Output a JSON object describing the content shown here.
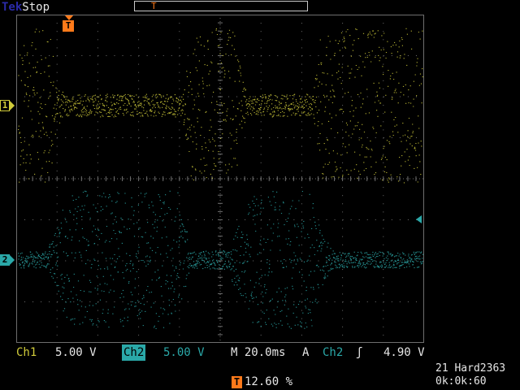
{
  "header": {
    "brand": "Tek",
    "state": "Stop",
    "record_marker": "T",
    "trigger_marker": "T"
  },
  "channels": {
    "ch1": {
      "marker": "1",
      "color": "#d0cb3a"
    },
    "ch2": {
      "marker": "2",
      "color": "#2aa8a8"
    }
  },
  "status_bar": {
    "ch1_label": "Ch1",
    "ch1_scale": "5.00 V",
    "ch2_label": "Ch2",
    "ch2_scale": "5.00 V",
    "timebase": "M 20.0ms",
    "trigger_mode": "A",
    "trigger_source": "Ch2",
    "trigger_slope": "ʃ",
    "trigger_level": "4.90 V"
  },
  "trigger_position": {
    "marker": "T",
    "percent": "12.60 %"
  },
  "info": {
    "line1": "21 Hard2363",
    "line2": "0k:0k:60"
  },
  "colors": {
    "grid": "#6e6e6e",
    "trigger": "#ff7a1a",
    "background": "#000000"
  }
}
